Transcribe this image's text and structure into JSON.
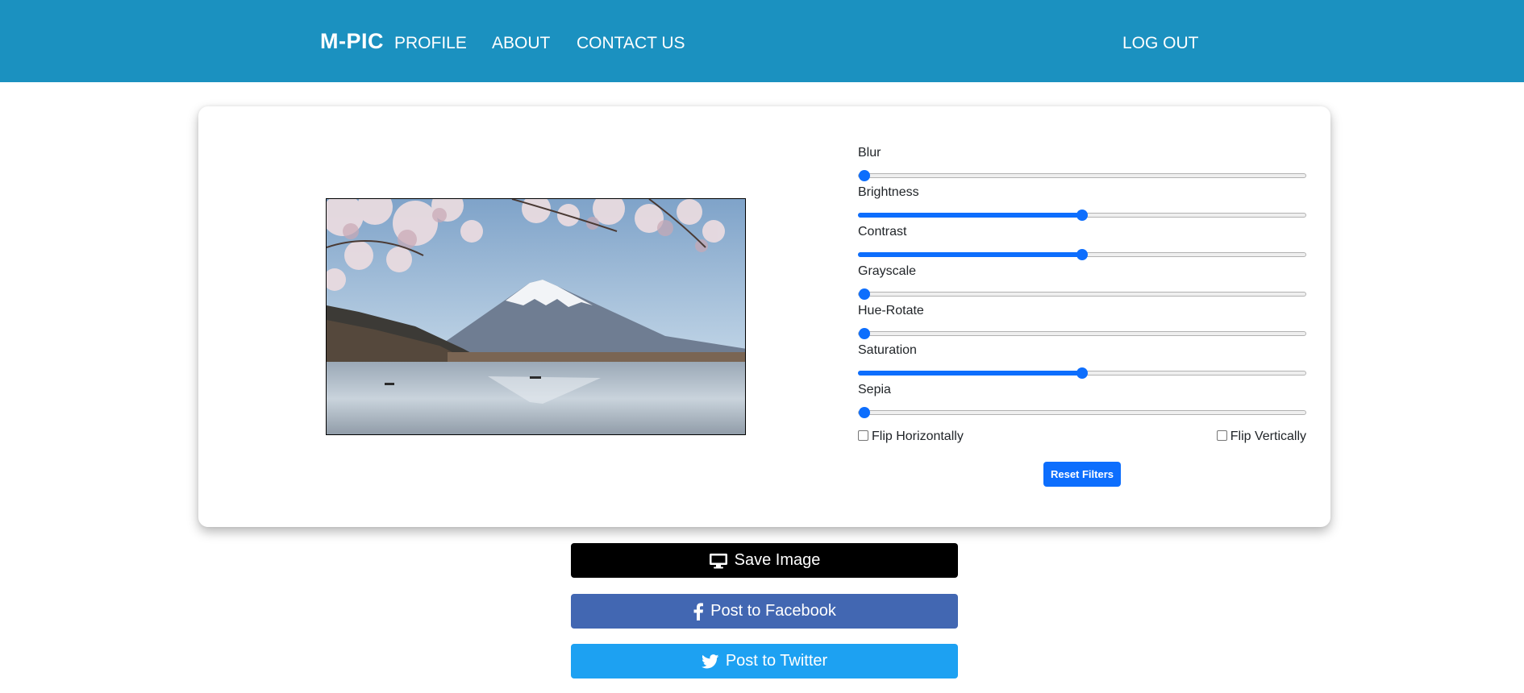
{
  "nav": {
    "brand": "M-PIC",
    "links": [
      "PROFILE",
      "ABOUT",
      "CONTACT US"
    ],
    "logout": "LOG OUT"
  },
  "editor": {
    "image_alt": "Mount Fuji with cherry blossoms over a lake",
    "filters": [
      {
        "label": "Blur",
        "value": 0
      },
      {
        "label": "Brightness",
        "value": 50
      },
      {
        "label": "Contrast",
        "value": 50
      },
      {
        "label": "Grayscale",
        "value": 0
      },
      {
        "label": "Hue-Rotate",
        "value": 0
      },
      {
        "label": "Saturation",
        "value": 50
      },
      {
        "label": "Sepia",
        "value": 0
      }
    ],
    "flip_horizontal": "Flip Horizontally",
    "flip_vertical": "Flip Vertically",
    "reset": "Reset Filters"
  },
  "actions": {
    "save": {
      "label": "Save Image",
      "icon": "desktop-icon"
    },
    "facebook": {
      "label": "Post to Facebook",
      "icon": "facebook-icon"
    },
    "twitter": {
      "label": "Post to Twitter",
      "icon": "twitter-icon"
    }
  },
  "colors": {
    "navbar": "#1b91c0",
    "accent": "#0d6efd",
    "facebook": "#4267b2",
    "twitter": "#1da1f2"
  }
}
